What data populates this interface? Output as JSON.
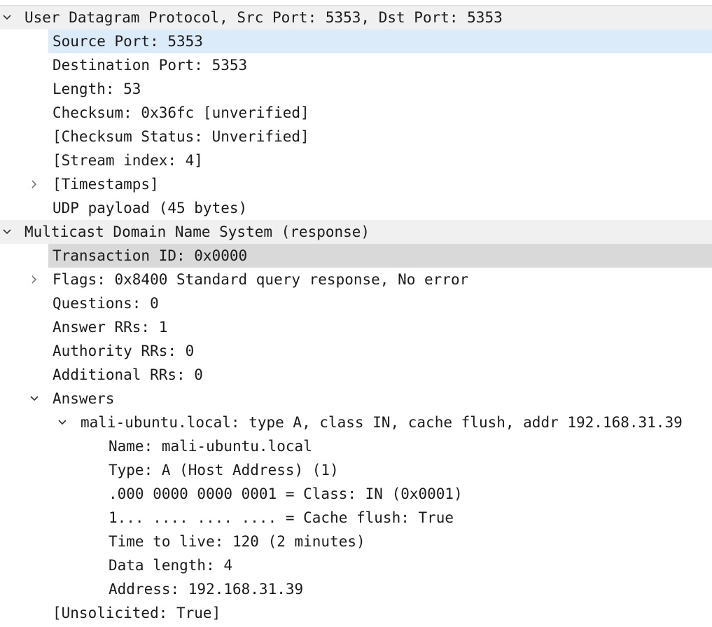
{
  "rows": {
    "udp_header": "User Datagram Protocol, Src Port: 5353, Dst Port: 5353",
    "source_port": "Source Port: 5353",
    "destination_port": "Destination Port: 5353",
    "length": "Length: 53",
    "checksum": "Checksum: 0x36fc [unverified]",
    "checksum_status": "[Checksum Status: Unverified]",
    "stream_index": "[Stream index: 4]",
    "timestamps": "[Timestamps]",
    "udp_payload": "UDP payload (45 bytes)",
    "mdns_header": "Multicast Domain Name System (response)",
    "transaction_id": "Transaction ID: 0x0000",
    "flags": "Flags: 0x8400 Standard query response, No error",
    "questions": "Questions: 0",
    "answer_rrs": "Answer RRs: 1",
    "authority_rrs": "Authority RRs: 0",
    "additional_rrs": "Additional RRs: 0",
    "answers": "Answers",
    "answer_record": "mali-ubuntu.local: type A, class IN, cache flush, addr 192.168.31.39",
    "name": "Name: mali-ubuntu.local",
    "type": "Type: A (Host Address) (1)",
    "class": ".000 0000 0000 0001 = Class: IN (0x0001)",
    "cache_flush": "1... .... .... .... = Cache flush: True",
    "ttl": "Time to live: 120 (2 minutes)",
    "data_length": "Data length: 4",
    "address": "Address: 192.168.31.39",
    "unsolicited": "[Unsolicited: True]"
  },
  "icons": {
    "expanded": "chevron-down-icon",
    "collapsed": "chevron-right-icon"
  },
  "colors": {
    "selected_row": "#dcebf9",
    "focus_row": "#d9d9d9",
    "header_row": "#f0f0f0"
  }
}
